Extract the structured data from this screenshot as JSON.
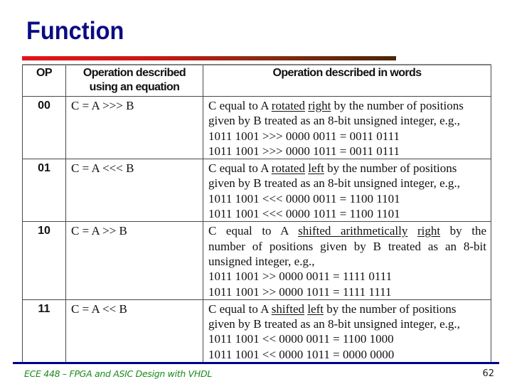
{
  "slide": {
    "title": "Function",
    "footer": "ECE 448 – FPGA and ASIC Design with VHDL",
    "page_number": "62",
    "colors": {
      "title": "#0b0b84",
      "footer_line": "#00008b",
      "footer_text": "#1a8a1a",
      "title_bar_start": "#e3141a",
      "title_bar_end": "#4a2508"
    }
  },
  "table": {
    "headers": [
      "OP",
      "Operation described using an equation",
      "Operation described in words"
    ],
    "rows": [
      {
        "op": "00",
        "equation": "C = A >>> B",
        "words": {
          "pre": "C equal to A ",
          "u1": "rotated",
          "mid": " ",
          "u2": "right",
          "post": " by the number of positions",
          "line2": "given by B treated as an 8-bit unsigned integer, e.g.,",
          "example1": "1011 1001 >>> 0000 0011 = 0011 0111",
          "example2": "1011 1001 >>> 0000 1011 = 0011 0111"
        }
      },
      {
        "op": "01",
        "equation": "C = A <<< B",
        "words": {
          "pre": "C equal to A ",
          "u1": "rotated",
          "mid": " ",
          "u2": "left",
          "post": " by the number of positions",
          "line2": "given by B treated as an 8-bit unsigned integer, e.g.,",
          "example1": "1011 1001 <<< 0000 0011 = 1100 1101",
          "example2": "1011 1001 <<< 0000 1011 = 1100 1101"
        }
      },
      {
        "op": "10",
        "equation": "C = A >> B",
        "words": {
          "pre": "C equal to A ",
          "u1": "shifted arithmetically",
          "mid": " ",
          "u2": "right",
          "post": " by the",
          "line2": "number of positions given by B treated as an 8-bit",
          "line3": "unsigned integer, e.g.,",
          "example1": "1011 1001 >> 0000 0011 = 1111 0111",
          "example2": "1011 1001 >> 0000 1011 = 1111 1111"
        }
      },
      {
        "op": "11",
        "equation": "C = A << B",
        "words": {
          "pre": "C equal to A ",
          "u1": "shifted",
          "mid": " ",
          "u2": "left",
          "post": " by the number of positions",
          "line2": "given by B treated as an 8-bit unsigned integer, e.g.,",
          "example1": "1011 1001 << 0000 0011 = 1100 1000",
          "example2": "1011 1001 << 0000 1011 = 0000 0000"
        }
      }
    ]
  }
}
